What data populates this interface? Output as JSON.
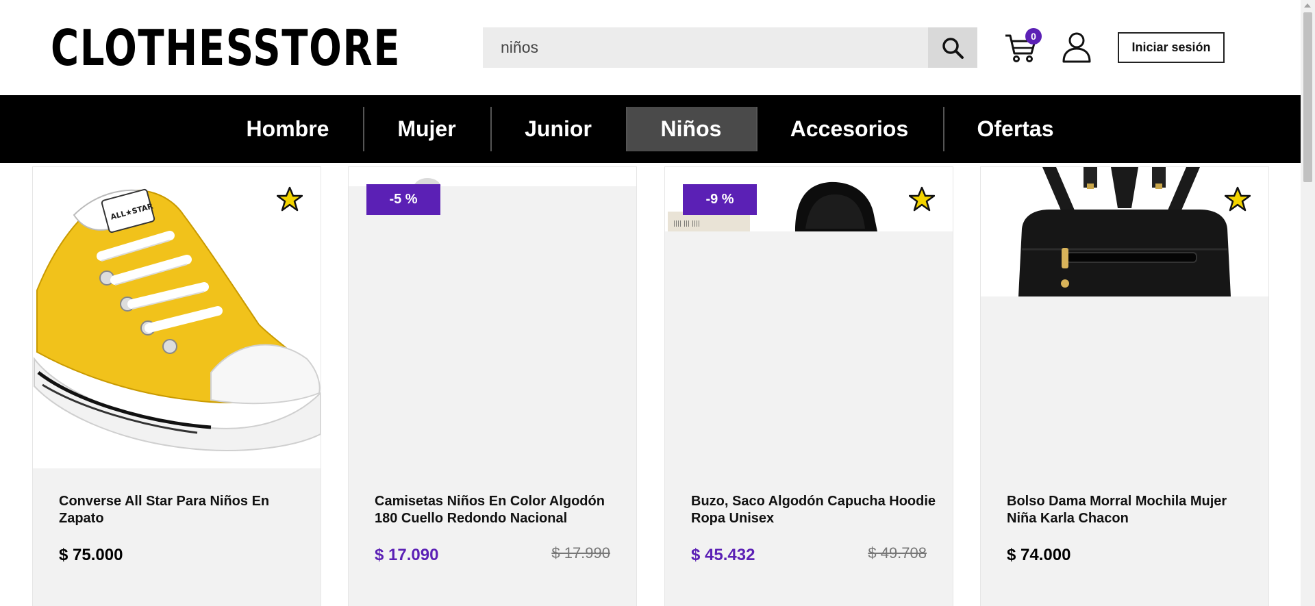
{
  "header": {
    "logo": "CLOTHESSTORE",
    "search_value": "niños",
    "cart_count": "0",
    "login_label": "Iniciar sesión"
  },
  "nav": {
    "items": [
      {
        "label": "Hombre"
      },
      {
        "label": "Mujer"
      },
      {
        "label": "Junior"
      },
      {
        "label": "Niños"
      },
      {
        "label": "Accesorios"
      },
      {
        "label": "Ofertas"
      }
    ],
    "active": "Niños"
  },
  "products": [
    {
      "title": "Converse All Star Para Niños En Zapato",
      "price": "$ 75.000",
      "old_price": "",
      "discount": ""
    },
    {
      "title": "Camisetas Niños En Color Algodón 180 Cuello Redondo Nacional",
      "price": "$ 17.090",
      "old_price": "$ 17.990",
      "discount": "-5 %"
    },
    {
      "title": "Buzo, Saco Algodón Capucha Hoodie Ropa Unisex",
      "price": "$ 45.432",
      "old_price": "$ 49.708",
      "discount": "-9 %"
    },
    {
      "title": "Bolso Dama Morral Mochila Mujer Niña Karla Chacon",
      "price": "$ 74.000",
      "old_price": "",
      "discount": ""
    }
  ],
  "colors": {
    "accent": "#5b20b5",
    "nav_bg": "#000000",
    "nav_active": "#4a4a4a",
    "card_bg": "#f2f2f2"
  },
  "icons": [
    "search-icon",
    "cart-icon",
    "user-icon",
    "star-icon"
  ]
}
